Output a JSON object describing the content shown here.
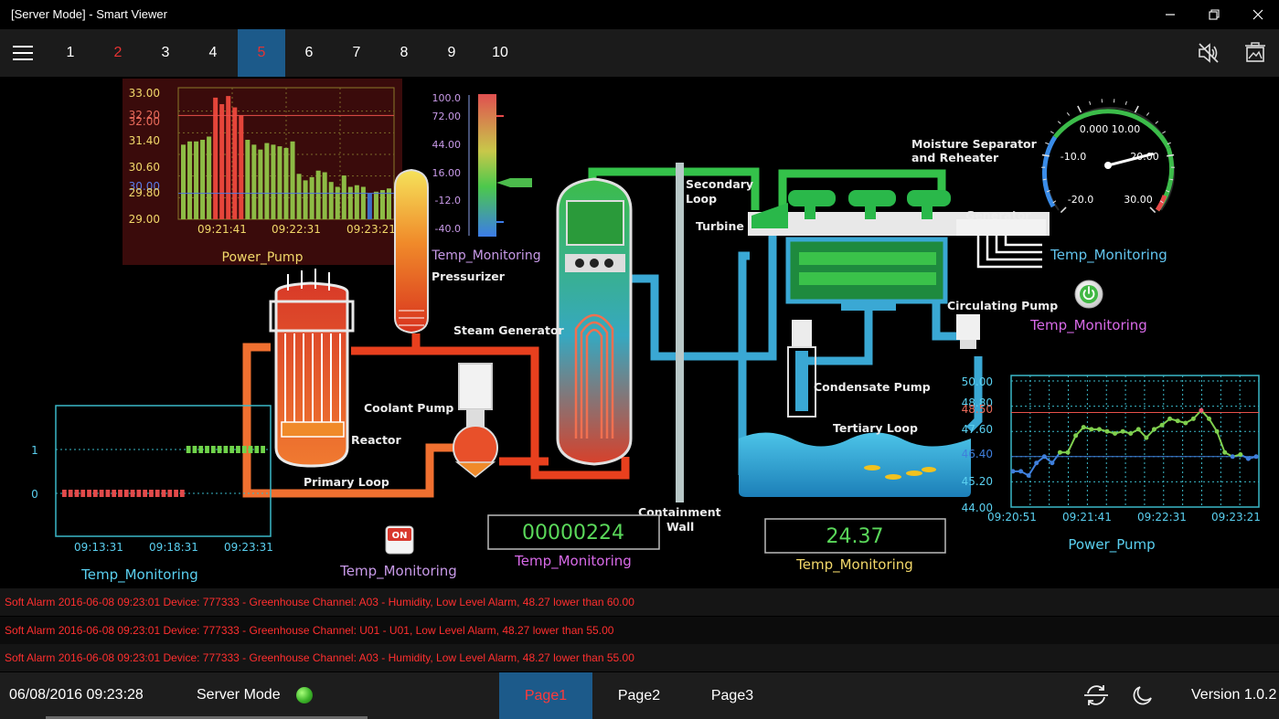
{
  "window": {
    "title": "[Server Mode] - Smart Viewer"
  },
  "toolbar": {
    "pages": [
      "1",
      "2",
      "3",
      "4",
      "5",
      "6",
      "7",
      "8",
      "9",
      "10"
    ],
    "alarm_page_index": 1,
    "active_page_index": 4
  },
  "bar_chart": {
    "title": "Power_Pump",
    "y_ticks": [
      "33.00",
      "32.20",
      "32.00",
      "31.40",
      "30.60",
      "30.00",
      "29.80",
      "29.00"
    ],
    "x_ticks": [
      "09:21:41",
      "09:22:31",
      "09:23:21"
    ]
  },
  "gradient_scale": {
    "title": "Temp_Monitoring",
    "ticks": [
      "100.0",
      "72.00",
      "44.00",
      "16.00",
      "-12.0",
      "-40.0"
    ],
    "current_value": 13
  },
  "gauge": {
    "title": "Temp_Monitoring",
    "labels": [
      "0.000 10.00",
      "-10.0",
      "20.00",
      "-20.0",
      "30.00"
    ],
    "value": 19
  },
  "power_button": {
    "title": "Temp_Monitoring"
  },
  "plant": {
    "labels": {
      "pressurizer": "Pressurizer",
      "steam_generator": "Steam Generator",
      "coolant_pump": "Coolant Pump",
      "reactor": "Reactor",
      "primary_loop": "Primary Loop",
      "secondary_loop_1": "Secondary",
      "secondary_loop_2": "Loop",
      "turbine": "Turbine",
      "moisture_1": "Moisture Separator",
      "moisture_2": "and Reheater",
      "generator": "Generator",
      "circulating_pump": "Circulating Pump",
      "condensate_pump": "Condensate Pump",
      "tertiary_loop": "Tertiary Loop",
      "containment_1": "Containment",
      "containment_2": "Wall"
    }
  },
  "digital_chart": {
    "title": "Temp_Monitoring",
    "y_ticks": [
      "1",
      "0"
    ],
    "x_ticks": [
      "09:13:31",
      "09:18:31",
      "09:23:31"
    ]
  },
  "toggle": {
    "label": "ON",
    "title": "Temp_Monitoring"
  },
  "counter": {
    "value": "00000224",
    "title": "Temp_Monitoring"
  },
  "numeric": {
    "value": "24.37",
    "title": "Temp_Monitoring"
  },
  "line_chart": {
    "title": "Power_Pump",
    "y_ticks": [
      "50.00",
      "48.80",
      "48.50",
      "47.60",
      "46.40",
      "45.20",
      "44.00"
    ],
    "x_ticks": [
      "09:20:51",
      "09:21:41",
      "09:22:31",
      "09:23:21"
    ]
  },
  "chart_data": [
    {
      "type": "bar",
      "title": "Power_Pump",
      "x_ticks": [
        "09:21:41",
        "09:22:31",
        "09:23:21"
      ],
      "ylim": [
        29.0,
        33.0
      ],
      "thresholds": {
        "high": 32.2,
        "low": 29.8
      },
      "values": [
        31.3,
        31.4,
        31.4,
        31.45,
        31.55,
        32.75,
        32.55,
        32.8,
        32.45,
        32.2,
        31.45,
        31.3,
        31.15,
        31.35,
        31.3,
        31.25,
        31.2,
        31.4,
        30.4,
        30.2,
        30.3,
        30.5,
        30.45,
        30.15,
        30.0,
        30.35,
        30.0,
        30.05,
        30.0,
        29.8,
        29.85,
        29.9,
        29.95
      ],
      "colors": {
        "normal": "#8dbb45",
        "high": "#e5453a",
        "low": "#3d6fc5"
      }
    },
    {
      "type": "line",
      "title": "Power_Pump",
      "x_ticks": [
        "09:20:51",
        "09:21:41",
        "09:22:31",
        "09:23:21"
      ],
      "ylim": [
        44.0,
        50.0
      ],
      "thresholds": {
        "high": 48.5,
        "low": 46.4
      },
      "values": [
        45.7,
        45.7,
        45.5,
        46.1,
        46.4,
        46.1,
        46.6,
        46.6,
        47.4,
        47.8,
        47.7,
        47.7,
        47.6,
        47.5,
        47.6,
        47.5,
        47.7,
        47.3,
        47.7,
        47.9,
        48.2,
        48.1,
        48.0,
        48.2,
        48.6,
        48.2,
        47.6,
        46.6,
        46.4,
        46.5,
        46.3,
        46.4
      ],
      "colors": {
        "normal": "#7fcf4e",
        "high": "#e8576e",
        "low": "#3f7fdc"
      }
    },
    {
      "type": "line",
      "title": "Temp_Monitoring",
      "x_ticks": [
        "09:13:31",
        "09:18:31",
        "09:23:31"
      ],
      "ylim": [
        0,
        1
      ],
      "step": true,
      "values": [
        0,
        0,
        0,
        0,
        0,
        0,
        0,
        0,
        0,
        0,
        0,
        0,
        0,
        0,
        0,
        0,
        0,
        0,
        0,
        0,
        1,
        1,
        1,
        1,
        1,
        1,
        1,
        1,
        1,
        1,
        1,
        1,
        1
      ],
      "colors": {
        "zero": "#e24a4a",
        "one": "#6fd34a"
      }
    }
  ],
  "alarms": [
    "Soft Alarm 2016-06-08 09:23:01 Device: 777333 - Greenhouse Channel: A03 - Humidity, Low Level Alarm, 48.27 lower than 60.00",
    "Soft Alarm 2016-06-08 09:23:01 Device: 777333 - Greenhouse Channel: U01 - U01, Low Level Alarm, 48.27 lower than 55.00",
    "Soft Alarm 2016-06-08 09:23:01 Device: 777333 - Greenhouse Channel: A03 - Humidity, Low Level Alarm, 48.27 lower than 55.00"
  ],
  "status": {
    "datetime": "06/08/2016 09:23:28",
    "mode": "Server Mode",
    "tabs": [
      "Page1",
      "Page2",
      "Page3"
    ],
    "version": "Version 1.0.2"
  },
  "icons": [
    "menu-icon",
    "mute-icon",
    "screenshot-icon",
    "minimize-icon",
    "restore-icon",
    "close-icon",
    "sync-icon",
    "moon-icon",
    "power-icon"
  ]
}
